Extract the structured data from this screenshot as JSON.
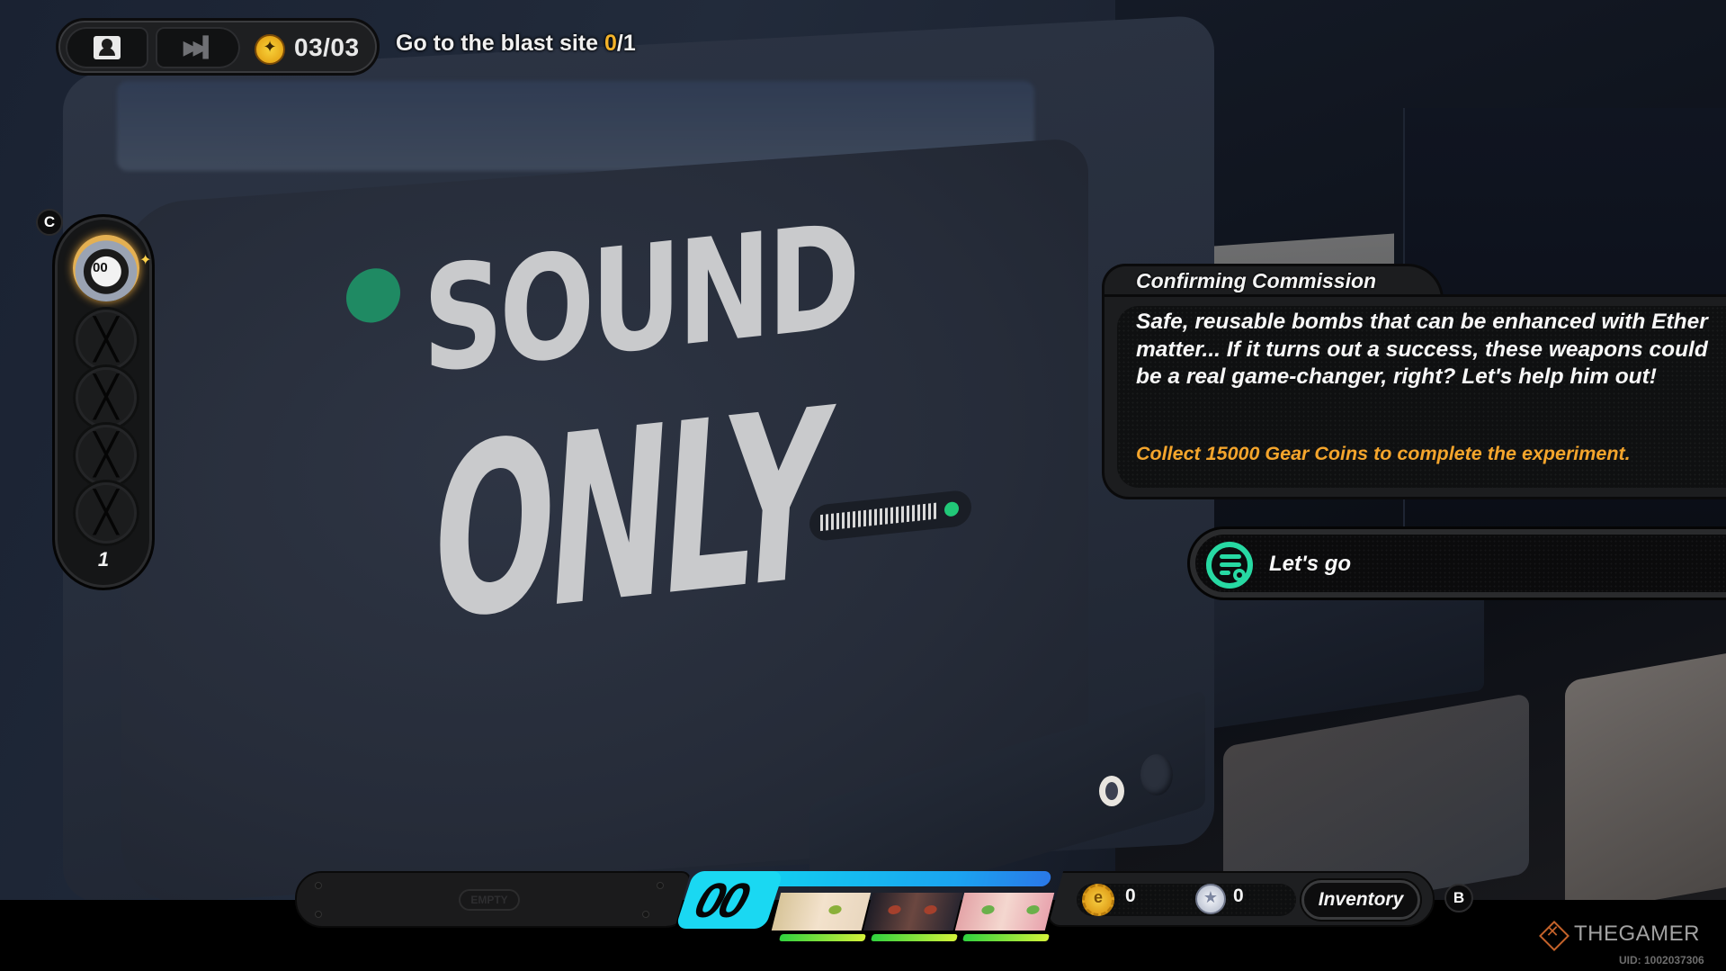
{
  "top_hud": {
    "profile_button_icon": "profile-icon",
    "skip_button_icon": "fast-forward-icon",
    "currency_icon": "commission-coin-icon",
    "count": "03/03",
    "objective": {
      "label": "Go to the blast site",
      "progress": "0",
      "separator": "/",
      "total": "1"
    }
  },
  "bangboo_panel": {
    "hotkey": "C",
    "active_slot": "bangboo-avatar",
    "empty_slots": 4,
    "count": "1"
  },
  "dialog": {
    "title": "Confirming Commission",
    "text": "Safe, reusable bombs that can be enhanced with Ether matter... If it turns out a success, these weapons could be a real game-changer, right? Let's help him out!",
    "goal": "Collect 15000 Gear Coins to complete the experiment."
  },
  "option": {
    "label": "Let's go",
    "icon": "dialog-option-icon",
    "accent_color": "#27d9a3"
  },
  "tv_screen": {
    "line1": "SOUND",
    "line2": "ONLY"
  },
  "bottom_hud": {
    "item_slot": "EMPTY",
    "squad_logo": "00",
    "squad": [
      {
        "name": "agent-1",
        "hp_fraction": 1.0
      },
      {
        "name": "agent-2",
        "hp_fraction": 1.0
      },
      {
        "name": "agent-3",
        "hp_fraction": 1.0
      }
    ],
    "gear_coins": "0",
    "star_coins": "0",
    "inventory_label": "Inventory",
    "inventory_hotkey": "B"
  },
  "watermark": {
    "brand": "THEGAMER",
    "uid": "UID: 1002037306"
  },
  "colors": {
    "objective_progress": "#f4b32a",
    "goal_text": "#f4a52c",
    "squad_accent": "#1ad8f2",
    "hp_bar": "#2fd13e"
  }
}
